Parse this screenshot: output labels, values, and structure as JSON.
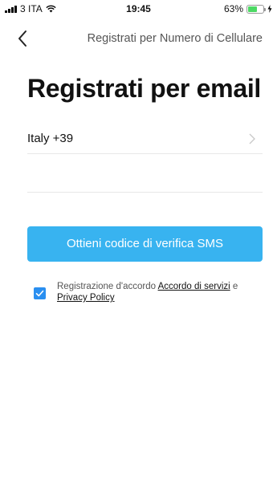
{
  "status_bar": {
    "carrier": "3 ITA",
    "time": "19:45",
    "battery_percent": "63%",
    "battery_level": 0.63
  },
  "nav": {
    "back_icon": "chevron-left-icon",
    "alt_register_link": "Registrati per Numero di Cellulare"
  },
  "title": "Registrati per email",
  "form": {
    "country_label": "Italy +39",
    "email_value": "",
    "email_placeholder": ""
  },
  "sms_button_label": "Ottieni codice di verifica SMS",
  "agreement": {
    "checked": true,
    "prefix": "Registrazione d'accordo ",
    "service_link": "Accordo di servizi",
    "connector": " e ",
    "privacy_link": "Privacy Policy"
  },
  "colors": {
    "primary": "#38b3f0",
    "checkbox": "#2a8ff0",
    "battery": "#4cd964"
  }
}
